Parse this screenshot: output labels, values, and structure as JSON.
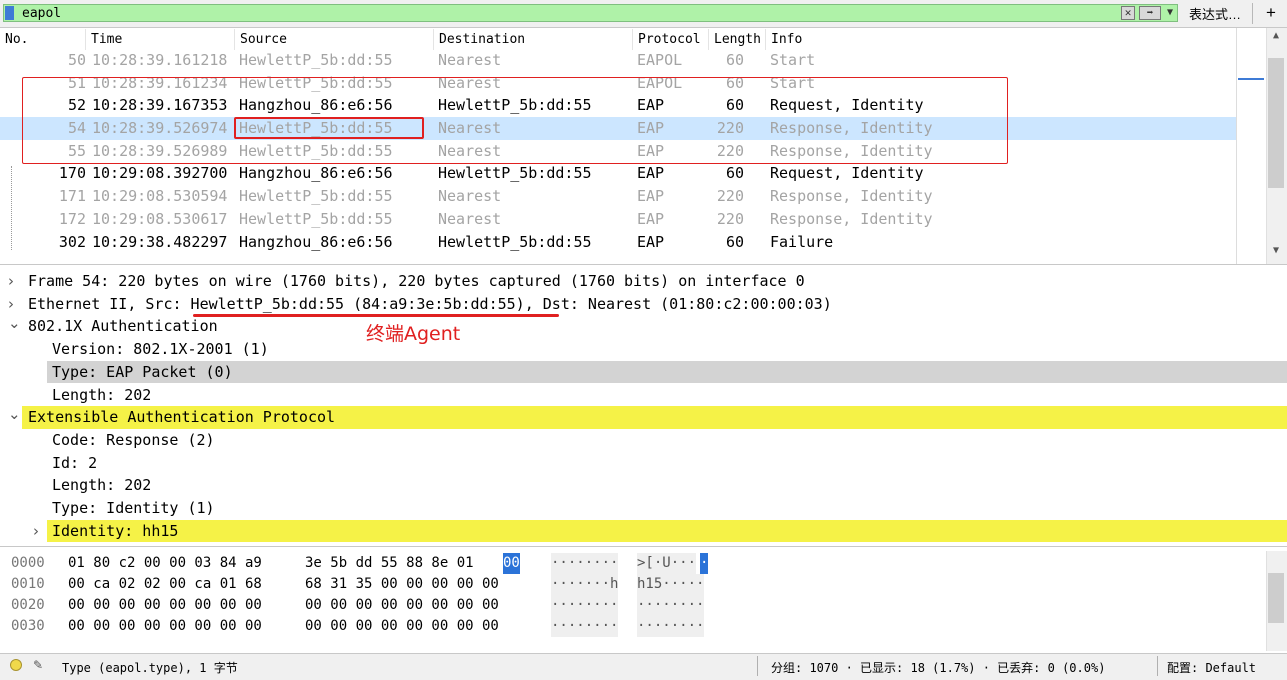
{
  "filter": {
    "value": "eapol",
    "expression_button": "表达式…",
    "add_label": "+"
  },
  "packet_list": {
    "columns": [
      "No.",
      "Time",
      "Source",
      "Destination",
      "Protocol",
      "Length",
      "Info"
    ],
    "rows": [
      {
        "no": "50",
        "time": "10:28:39.161218",
        "src": "HewlettP_5b:dd:55",
        "dst": "Nearest",
        "proto": "EAPOL",
        "len": "60",
        "info": "Start",
        "dim": true
      },
      {
        "no": "51",
        "time": "10:28:39.161234",
        "src": "HewlettP_5b:dd:55",
        "dst": "Nearest",
        "proto": "EAPOL",
        "len": "60",
        "info": "Start",
        "dim": true
      },
      {
        "no": "52",
        "time": "10:28:39.167353",
        "src": "Hangzhou_86:e6:56",
        "dst": "HewlettP_5b:dd:55",
        "proto": "EAP",
        "len": "60",
        "info": "Request, Identity",
        "dim": false
      },
      {
        "no": "54",
        "time": "10:28:39.526974",
        "src": "HewlettP_5b:dd:55",
        "dst": "Nearest",
        "proto": "EAP",
        "len": "220",
        "info": "Response, Identity",
        "dim": true,
        "selected": true
      },
      {
        "no": "55",
        "time": "10:28:39.526989",
        "src": "HewlettP_5b:dd:55",
        "dst": "Nearest",
        "proto": "EAP",
        "len": "220",
        "info": "Response, Identity",
        "dim": true
      },
      {
        "no": "170",
        "time": "10:29:08.392700",
        "src": "Hangzhou_86:e6:56",
        "dst": "HewlettP_5b:dd:55",
        "proto": "EAP",
        "len": "60",
        "info": "Request, Identity",
        "dim": false
      },
      {
        "no": "171",
        "time": "10:29:08.530594",
        "src": "HewlettP_5b:dd:55",
        "dst": "Nearest",
        "proto": "EAP",
        "len": "220",
        "info": "Response, Identity",
        "dim": true
      },
      {
        "no": "172",
        "time": "10:29:08.530617",
        "src": "HewlettP_5b:dd:55",
        "dst": "Nearest",
        "proto": "EAP",
        "len": "220",
        "info": "Response, Identity",
        "dim": true
      },
      {
        "no": "302",
        "time": "10:29:38.482297",
        "src": "Hangzhou_86:e6:56",
        "dst": "HewlettP_5b:dd:55",
        "proto": "EAP",
        "len": "60",
        "info": "Failure",
        "dim": false
      }
    ]
  },
  "details": [
    {
      "text": "Frame 54: 220 bytes on wire (1760 bits), 220 bytes captured (1760 bits) on interface 0",
      "indent": 0,
      "arrow": "collapsed",
      "hl": ""
    },
    {
      "text": "Ethernet II, Src: HewlettP_5b:dd:55 (84:a9:3e:5b:dd:55), Dst: Nearest (01:80:c2:00:00:03)",
      "indent": 0,
      "arrow": "collapsed",
      "hl": ""
    },
    {
      "text": "802.1X Authentication",
      "indent": 0,
      "arrow": "expanded",
      "hl": ""
    },
    {
      "text": "Version: 802.1X-2001 (1)",
      "indent": 1,
      "arrow": "",
      "hl": ""
    },
    {
      "text": "Type: EAP Packet (0)",
      "indent": 1,
      "arrow": "",
      "hl": "grey"
    },
    {
      "text": "Length: 202",
      "indent": 1,
      "arrow": "",
      "hl": ""
    },
    {
      "text": "Extensible Authentication Protocol",
      "indent": 0,
      "arrow": "expanded",
      "hl": "yellow"
    },
    {
      "text": "Code: Response (2)",
      "indent": 1,
      "arrow": "",
      "hl": ""
    },
    {
      "text": "Id: 2",
      "indent": 1,
      "arrow": "",
      "hl": ""
    },
    {
      "text": "Length: 202",
      "indent": 1,
      "arrow": "",
      "hl": ""
    },
    {
      "text": "Type: Identity (1)",
      "indent": 1,
      "arrow": "",
      "hl": ""
    },
    {
      "text": "Identity: hh15",
      "indent": 1,
      "arrow": "collapsed",
      "hl": "yellow"
    }
  ],
  "annotation": {
    "label": "终端Agent",
    "color": "#e02020"
  },
  "bytes": [
    {
      "offset": "0000",
      "hex1": "01 80 c2 00 00 03 84 a9",
      "hex2": "3e 5b dd 55 88 8e 01",
      "hex_sel": "00",
      "asc1": "········",
      "asc2": ">[·U···",
      "asc_sel": "·"
    },
    {
      "offset": "0010",
      "hex1": "00 ca 02 02 00 ca 01 68",
      "hex2": "68 31 35 00 00 00 00 00",
      "hex_sel": "",
      "asc1": "·······h",
      "asc2": "h15·····",
      "asc_sel": ""
    },
    {
      "offset": "0020",
      "hex1": "00 00 00 00 00 00 00 00",
      "hex2": "00 00 00 00 00 00 00 00",
      "hex_sel": "",
      "asc1": "········",
      "asc2": "········",
      "asc_sel": ""
    },
    {
      "offset": "0030",
      "hex1": "00 00 00 00 00 00 00 00",
      "hex2": "00 00 00 00 00 00 00 00",
      "hex_sel": "",
      "asc1": "········",
      "asc2": "········",
      "asc_sel": ""
    }
  ],
  "status": {
    "field_text": "Type (eapol.type), 1 字节",
    "stats": "分组: 1070 · 已显示: 18 (1.7%) · 已丢弃: 0 (0.0%)",
    "profile": "配置: Default"
  },
  "colors": {
    "filter_valid": "#aff2a8",
    "selected_row": "#cce6ff",
    "highlight_yellow": "#f5f247",
    "highlight_grey": "#d3d3d3",
    "annotation_red": "#e02020"
  }
}
